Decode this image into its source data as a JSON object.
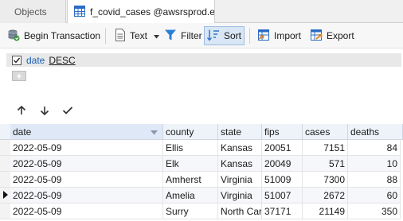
{
  "tabs": {
    "objects_label": "Objects",
    "active_label": "f_covid_cases @awsrsprod.ext ..."
  },
  "toolbar": {
    "begin_transaction": "Begin Transaction",
    "text": "Text",
    "filter": "Filter",
    "sort": "Sort",
    "import": "Import",
    "export": "Export"
  },
  "sort": {
    "field": "date",
    "direction": "DESC",
    "enabled": true
  },
  "table": {
    "columns": [
      "date",
      "county",
      "state",
      "fips",
      "cases",
      "deaths"
    ],
    "rows": [
      [
        "2022-05-09",
        "Ellis",
        "Kansas",
        "20051",
        "7151",
        "84"
      ],
      [
        "2022-05-09",
        "Elk",
        "Kansas",
        "20049",
        "571",
        "10"
      ],
      [
        "2022-05-09",
        "Amherst",
        "Virginia",
        "51009",
        "7300",
        "88"
      ],
      [
        "2022-05-09",
        "Amelia",
        "Virginia",
        "51007",
        "2672",
        "60"
      ],
      [
        "2022-05-09",
        "Surry",
        "North Car",
        "37171",
        "21149",
        "350"
      ]
    ],
    "current_row": 3
  },
  "colors": {
    "sort_field": "#1a5fb4",
    "accent": "#2b6cc4"
  }
}
